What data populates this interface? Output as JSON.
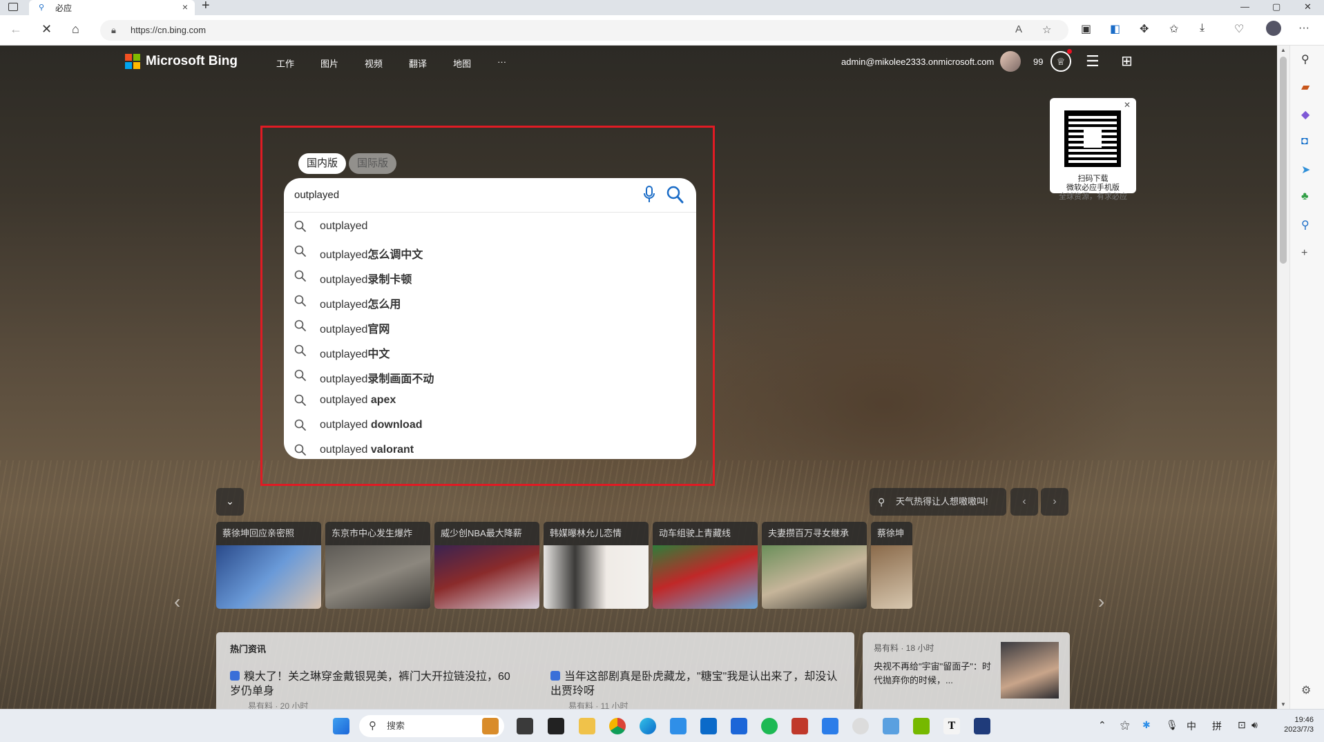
{
  "browser": {
    "tab_title": "必应",
    "url": "https://cn.bing.com",
    "window_controls": {
      "minimize": "—",
      "maximize": "▢",
      "close": "✕"
    },
    "new_tab": "+",
    "colors": {
      "accent": "#1a6cc7"
    }
  },
  "header": {
    "logo_text": "Microsoft Bing",
    "logo_colors": [
      "#f25022",
      "#7fba00",
      "#00a4ef",
      "#ffb900"
    ],
    "nav": [
      "工作",
      "图片",
      "视频",
      "翻译",
      "地图",
      "···"
    ],
    "account": "admin@mikolee2333.onmicrosoft.com",
    "points": "99"
  },
  "qr_card": {
    "line1": "扫码下载",
    "line2": "微软必应手机版",
    "line3": "全球资源，有求必应",
    "close": "✕"
  },
  "search": {
    "tabs": [
      "国内版",
      "国际版"
    ],
    "query": "outplayed",
    "suggestions": [
      {
        "base": "outplayed",
        "bold": ""
      },
      {
        "base": "outplayed",
        "bold": "怎么调中文"
      },
      {
        "base": "outplayed",
        "bold": "录制卡顿"
      },
      {
        "base": "outplayed",
        "bold": "怎么用"
      },
      {
        "base": "outplayed",
        "bold": "官网"
      },
      {
        "base": "outplayed",
        "bold": "中文"
      },
      {
        "base": "outplayed",
        "bold": "录制画面不动"
      },
      {
        "base": "outplayed ",
        "bold": "apex"
      },
      {
        "base": "outplayed ",
        "bold": "download"
      },
      {
        "base": "outplayed ",
        "bold": "valorant"
      }
    ],
    "highlight_color": "#e01b24"
  },
  "weather": "天气热得让人想嗷嗷叫!",
  "trending": [
    {
      "title": "蔡徐坤回应亲密照"
    },
    {
      "title": "东京市中心发生爆炸"
    },
    {
      "title": "威少创NBA最大降薪"
    },
    {
      "title": "韩媒曝林允儿恋情"
    },
    {
      "title": "动车组驶上青藏线"
    },
    {
      "title": "夫妻攒百万寻女继承"
    },
    {
      "title": "蔡徐坤发文"
    }
  ],
  "news": {
    "heading": "热门资讯",
    "items": [
      {
        "title": "糗大了！关之琳穿金戴银晃美，裤门大开拉链没拉，60岁仍单身",
        "source": "易有料 · 20 小时"
      },
      {
        "title": "当年这部剧真是卧虎藏龙，\"糖宝\"我是认出来了，却没认出贾玲呀",
        "source": "易有料 · 11 小时"
      }
    ],
    "side": {
      "source": "易有料 · 18 小时",
      "title": "央视不再给\"宇宙\"留面子\"：时代抛弃你的时候，..."
    }
  },
  "taskbar": {
    "search": "搜索",
    "ime1": "中",
    "ime2": "拼",
    "time": "19:46",
    "date": "2023/7/3"
  }
}
